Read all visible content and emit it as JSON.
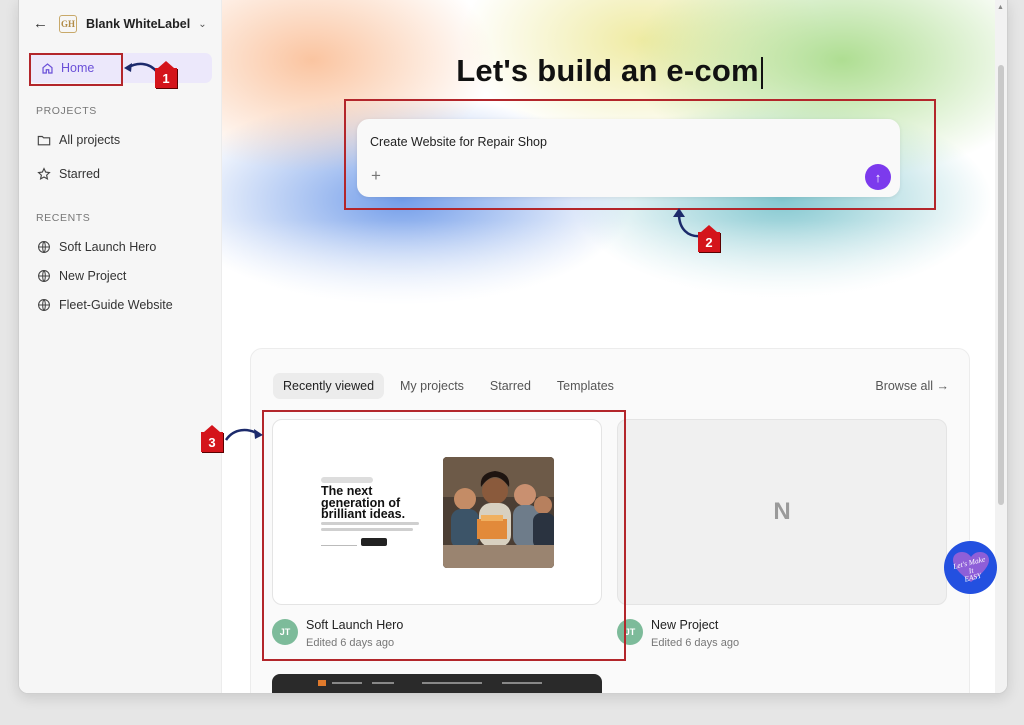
{
  "workspace": {
    "name": "Blank WhiteLabel",
    "logo_text": "GH"
  },
  "sidebar": {
    "home_label": "Home",
    "projects_heading": "PROJECTS",
    "projects": [
      {
        "label": "All projects"
      },
      {
        "label": "Starred"
      }
    ],
    "recents_heading": "RECENTS",
    "recents": [
      {
        "label": "Soft Launch Hero"
      },
      {
        "label": "New Project"
      },
      {
        "label": "Fleet-Guide Website"
      }
    ]
  },
  "hero": {
    "title": "Let's build an e-com"
  },
  "prompt": {
    "value": "Create Website for Repair Shop"
  },
  "tabs": [
    {
      "label": "Recently viewed"
    },
    {
      "label": "My projects"
    },
    {
      "label": "Starred"
    },
    {
      "label": "Templates"
    }
  ],
  "browse_all": "Browse all →",
  "cards": [
    {
      "name": "Soft Launch Hero",
      "edited": "Edited 6 days ago",
      "initials": "JT",
      "thumb_headline": "The next generation of brilliant ideas."
    },
    {
      "name": "New Project",
      "edited": "Edited 6 days ago",
      "initials": "JT",
      "letter": "N"
    }
  ],
  "annotations": [
    "1",
    "2",
    "3"
  ],
  "fab": {
    "line1": "Let's Make",
    "line2": "It",
    "line3": "EASY"
  },
  "colors": {
    "accent": "#7c3aed",
    "annotation": "#d4141b",
    "avatar": "#7dbb9a",
    "fab": "#2350e0"
  }
}
